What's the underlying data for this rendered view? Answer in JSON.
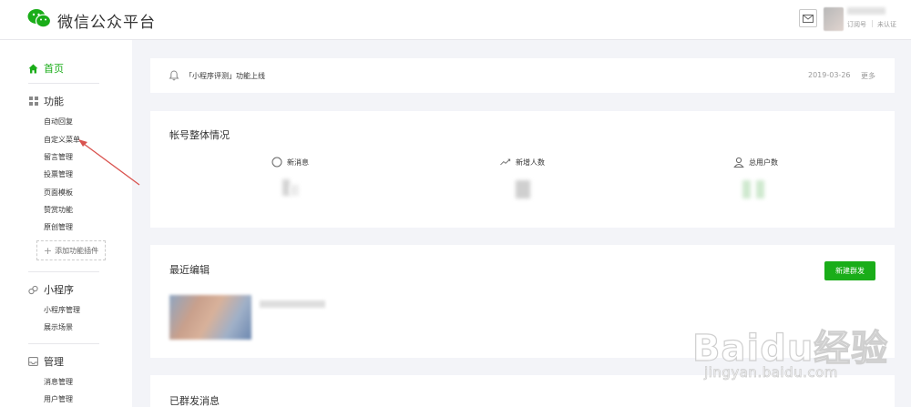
{
  "header": {
    "brand": "微信公众平台",
    "account_type": "订阅号",
    "account_status": "未认证"
  },
  "sidebar": {
    "home": "首页",
    "features": {
      "title": "功能",
      "items": [
        "自动回复",
        "自定义菜单",
        "留言管理",
        "投票管理",
        "页面模板",
        "赞赏功能",
        "原创管理"
      ],
      "add_plugin": "添加功能插件"
    },
    "mini_program": {
      "title": "小程序",
      "items": [
        "小程序管理",
        "展示场景"
      ]
    },
    "management": {
      "title": "管理",
      "items": [
        "消息管理",
        "用户管理"
      ]
    }
  },
  "notice": {
    "text": "「小程序评测」功能上线",
    "date": "2019-03-26",
    "more": "更多"
  },
  "overview": {
    "title": "帐号整体情况",
    "stats": [
      {
        "label": "新消息",
        "icon": "chat-bubble-icon"
      },
      {
        "label": "新增人数",
        "icon": "trend-line-icon"
      },
      {
        "label": "总用户数",
        "icon": "user-icon"
      }
    ]
  },
  "recent": {
    "title": "最近编辑",
    "new_button": "新建群发"
  },
  "sent": {
    "title": "已群发消息"
  },
  "watermark": {
    "line1": "Baidu经验",
    "line2": "jingyan.baidu.com"
  },
  "colors": {
    "accent": "#1aad19",
    "annotation_arrow": "#d9534f"
  }
}
